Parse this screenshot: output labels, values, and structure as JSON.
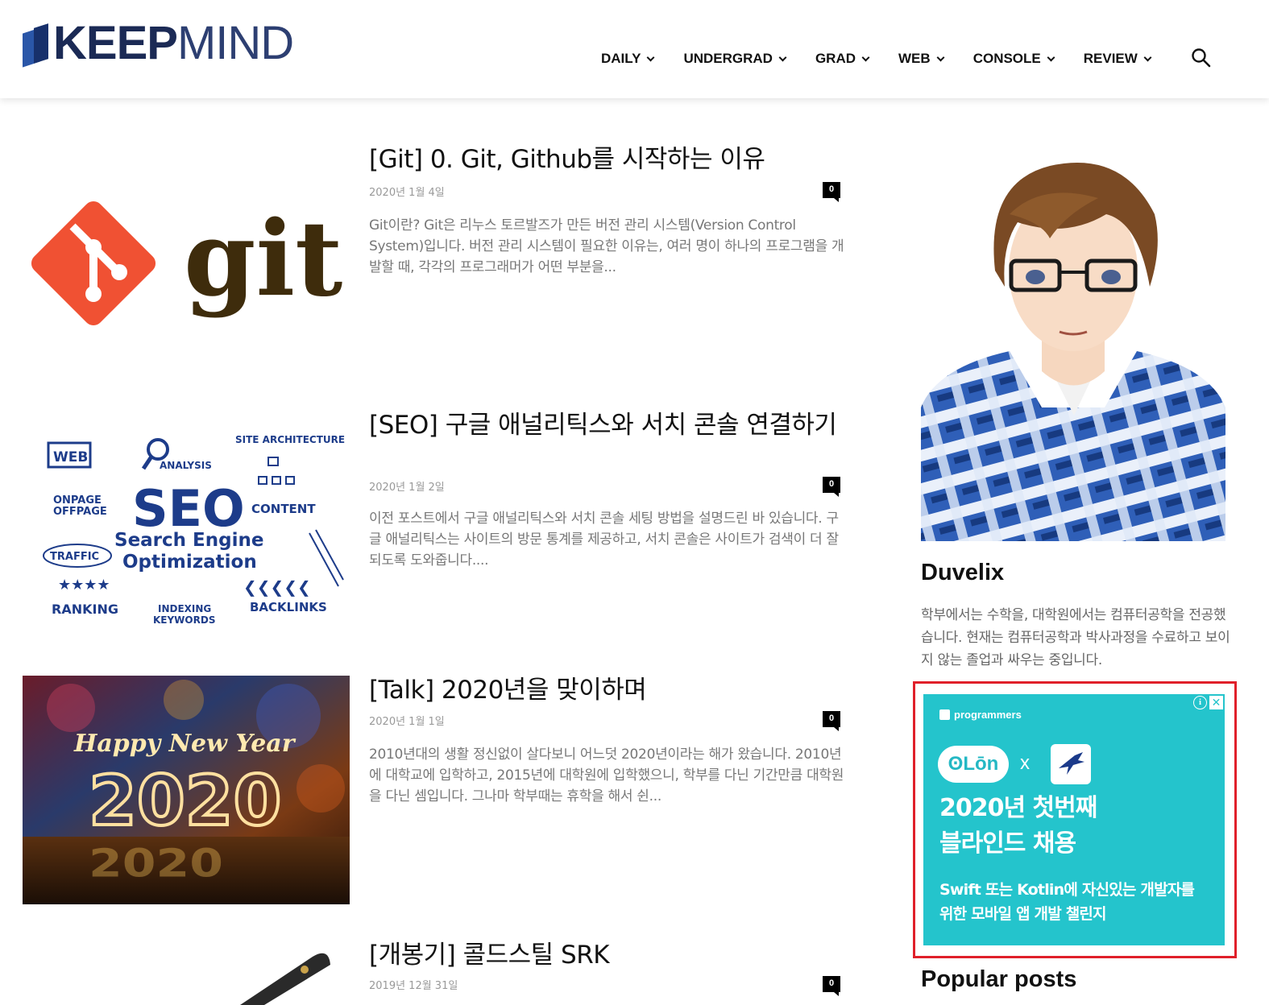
{
  "header": {
    "logo_bold": "KEEP",
    "logo_light": "MIND",
    "nav": [
      {
        "label": "DAILY"
      },
      {
        "label": "UNDERGRAD"
      },
      {
        "label": "GRAD"
      },
      {
        "label": "WEB"
      },
      {
        "label": "CONSOLE"
      },
      {
        "label": "REVIEW"
      }
    ],
    "search_icon": "search-icon"
  },
  "posts": [
    {
      "title": "[Git] 0. Git, Github를 시작하는 이유",
      "date": "2020년 1월 4일",
      "comments": "0",
      "excerpt": "Git이란? Git은 리누스 토르발즈가 만든 버전 관리 시스템(Version Control System)입니다. 버전 관리 시스템이 필요한 이유는, 여러 명이 하나의 프로그램을 개발할 때, 각각의 프로그래머가 어떤 부분을...",
      "thumb_text": "git"
    },
    {
      "title": "[SEO] 구글 애널리틱스와 서치 콘솔 연결하기",
      "date": "2020년 1월 2일",
      "comments": "0",
      "excerpt": "이전 포스트에서 구글 애널리틱스와 서치 콘솔 세팅 방법을 설명드린 바 있습니다. 구글 애널리틱스는 사이트의 방문 통계를 제공하고, 서치 콘솔은 사이트가 검색이 더 잘되도록 도와줍니다....",
      "thumb_words": {
        "seo": "SEO",
        "line1": "Search Engine",
        "line2": "Optimization",
        "web": "WEB",
        "analysis": "ANALYSIS",
        "site_arch": "SITE ARCHITECTURE",
        "onpage": "ONPAGE",
        "offpage": "OFFPAGE",
        "content": "CONTENT",
        "traffic": "TRAFFIC",
        "ranking": "RANKING",
        "indexing": "INDEXING",
        "keywords": "KEYWORDS",
        "backlinks": "BACKLINKS"
      }
    },
    {
      "title": "[Talk] 2020년을 맞이하며",
      "date": "2020년 1월 1일",
      "comments": "0",
      "excerpt": "2010년대의 생활 정신없이 살다보니 어느덧 2020년이라는 해가 왔습니다. 2010년에 대학교에 입학하고, 2015년에 대학원에 입학했으니, 학부를 다닌 기간만큼 대학원을 다닌 셈입니다. 그나마 학부때는 휴학을 해서 쉰...",
      "thumb_line1": "Happy New Year",
      "thumb_line2": "2020"
    },
    {
      "title": "[개봉기] 콜드스틸 SRK",
      "date": "2019년 12월 31일",
      "comments": "0"
    }
  ],
  "sidebar": {
    "author_name": "Duvelix",
    "author_bio": "학부에서는 수학을, 대학원에서는 컴퓨터공학을 전공했습니다. 현재는 컴퓨터공학과 박사과정을 수료하고 보이지 않는 졸업과 싸우는 중입니다.",
    "ad": {
      "brand": "programmers",
      "logo_text": "ʘLōn",
      "x": "x",
      "info": "i",
      "close": "✕",
      "headline_1": "2020년 첫번째",
      "headline_2": "블라인드 채용",
      "sub_1": "Swift 또는 Kotlin에 자신있는 개발자를",
      "sub_2": "위한 모바일 앱 개발 챌린지"
    },
    "popular_title": "Popular posts"
  },
  "colors": {
    "logo_dark": "#1b2a55",
    "git_orange": "#f05133",
    "git_brown": "#3e2c0c",
    "seo_blue": "#1d3c8a",
    "ad_teal": "#24c4cc",
    "highlight_red": "#e0202a"
  }
}
